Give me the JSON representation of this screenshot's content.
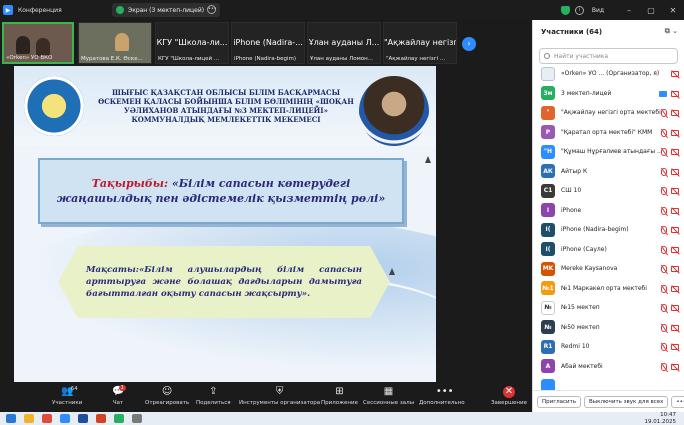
{
  "window": {
    "app_title": "Конференция",
    "share_tab": "Экран (3 мектеп-лицей)",
    "view_label": "Вид"
  },
  "thumbnails": [
    {
      "label": "«Örken» УО ВКО",
      "type": "camera"
    },
    {
      "label": "Муратова Е.К. Өске...",
      "type": "camera"
    },
    {
      "label": "КГУ \"Школа-лицей ...",
      "name": "КГУ \"Школа-ли...",
      "type": "name"
    },
    {
      "label": "iPhone (Nadira-begim)",
      "name": "iPhone (Nadira-...",
      "type": "name"
    },
    {
      "label": "Ұлан ауданы Ломон...",
      "name": "Ұлан ауданы Л...",
      "type": "name"
    },
    {
      "label": "\"Ақжайлау негізгі ...",
      "name": "\"Ақжайлау негізгі...",
      "type": "name"
    }
  ],
  "slide": {
    "header": "ШЫҒЫС ҚАЗАҚСТАН ОБЛЫСЫ БІЛІМ БАСҚАРМАСЫ ӨСКЕМЕН ҚАЛАСЫ БОЙЫНША БІЛІМ БӨЛІМІНІҢ «ШОҚАН УӘЛИХАНОВ АТЫНДАҒЫ №3 МЕКТЕП-ЛИЦЕЙІ» КОММУНАЛДЫҚ МЕМЛЕКЕТТІК МЕКЕМЕСІ",
    "topic_label": "Тақырыбы:",
    "topic_text": "«Білім сапасын көтерудегі жаңашылдық пен әдістемелік қызметтің рөлі»",
    "purpose_label": "Мақсаты:",
    "purpose_text": "«Білім алушылардың білім сапасын арттыруға және болашақ дағдыларын дамытуға бағытталған оқыту сапасын жақсырту»."
  },
  "toolbar": {
    "participants_label": "Участники",
    "participants_count": "64",
    "chat_label": "Чат",
    "chat_badge": "1",
    "react_label": "Отреагировать",
    "share_label": "Поделиться",
    "host_tools_label": "Инструменты организатора",
    "apps_label": "Приложение",
    "breakout_label": "Сессионные залы",
    "more_label": "Дополнительно",
    "end_label": "Завершение"
  },
  "panel": {
    "title": "Участники (64)",
    "search_placeholder": "Найти участника",
    "participants": [
      {
        "initials": "",
        "name": "«Örken» УО ... (Организатор, я)",
        "color": "#e8eef4"
      },
      {
        "initials": "3м",
        "name": "3 мектеп-лицей",
        "color": "#27ae60"
      },
      {
        "initials": "\"",
        "name": "\"Ақжайлау негізгі орта мектебі\"",
        "color": "#e0642e"
      },
      {
        "initials": "Р",
        "name": "\"Қаратал орта мектебі\" КММ",
        "color": "#9b59b6"
      },
      {
        "initials": "\"Н",
        "name": "\"Құмаш Нұрғалиев атындағы ...",
        "color": "#2d8cff"
      },
      {
        "initials": "АК",
        "name": "Айтыр К",
        "color": "#2d6fb7"
      },
      {
        "initials": "С1",
        "name": "СШ 10",
        "color": "#3a3a3a"
      },
      {
        "initials": "I",
        "name": "iPhone",
        "color": "#8e44ad"
      },
      {
        "initials": "I(",
        "name": "iPhone (Nadira-begim)",
        "color": "#1d4e6b"
      },
      {
        "initials": "I(",
        "name": "iPhone (Сауле)",
        "color": "#1d4e6b"
      },
      {
        "initials": "MK",
        "name": "Mereke Kaysanova",
        "color": "#d35400"
      },
      {
        "initials": "№1",
        "name": "№1 Маркакөл орта мектебі",
        "color": "#f39c12"
      },
      {
        "initials": "№",
        "name": "№15 мектеп",
        "color": "#ffffff"
      },
      {
        "initials": "№",
        "name": "№50 мектеп",
        "color": "#2c3e50"
      },
      {
        "initials": "R1",
        "name": "Redmi 10",
        "color": "#2d6fb7"
      },
      {
        "initials": "А",
        "name": "Абай мектебі",
        "color": "#8e44ad"
      },
      {
        "initials": "",
        "name": "",
        "color": "#2d8cff"
      }
    ],
    "invite_label": "Пригласить",
    "mute_all_label": "Выключить звук для всех"
  },
  "taskbar": {
    "time": "10:47",
    "date": "19.01.2025"
  }
}
